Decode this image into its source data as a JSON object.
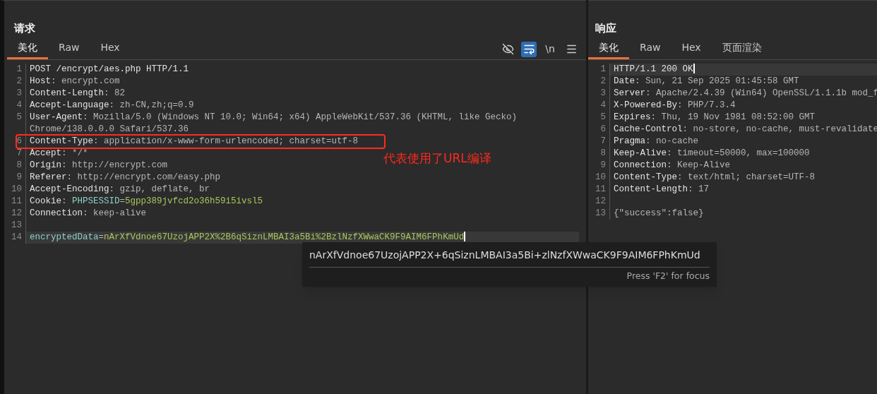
{
  "request": {
    "title": "请求",
    "tabs": [
      {
        "label": "美化",
        "selected": true
      },
      {
        "label": "Raw",
        "selected": false
      },
      {
        "label": "Hex",
        "selected": false
      }
    ],
    "toolbar": [
      {
        "kind": "eye-off",
        "selected": false
      },
      {
        "kind": "wrap",
        "selected": true
      },
      {
        "kind": "newline",
        "label": "\\n",
        "selected": false
      },
      {
        "kind": "menu",
        "selected": false
      }
    ],
    "lines": [
      {
        "number": "1",
        "parts": [
          {
            "text": "POST /encrypt/aes.php HTTP/1.1",
            "kind": "key"
          }
        ],
        "current": false
      },
      {
        "number": "2",
        "parts": [
          {
            "text": "Host",
            "kind": "key"
          },
          {
            "text": ": encrypt.com",
            "kind": "value"
          }
        ],
        "current": false
      },
      {
        "number": "3",
        "parts": [
          {
            "text": "Content-Length",
            "kind": "key"
          },
          {
            "text": ": 82",
            "kind": "value"
          }
        ],
        "current": false
      },
      {
        "number": "4",
        "parts": [
          {
            "text": "Accept-Language",
            "kind": "key"
          },
          {
            "text": ": zh-CN,zh;q=0.9",
            "kind": "value"
          }
        ],
        "current": false
      },
      {
        "number": "5",
        "parts": [
          {
            "text": "User-Agent",
            "kind": "key"
          },
          {
            "text": ": Mozilla/5.0 (Windows NT 10.0; Win64; x64) AppleWebKit/537.36 (KHTML, like Gecko)",
            "kind": "value"
          }
        ],
        "continuation": "Chrome/138.0.0.0 Safari/537.36",
        "current": false
      },
      {
        "number": "6",
        "parts": [
          {
            "text": "Content-Type",
            "kind": "key"
          },
          {
            "text": ": application/x-www-form-urlencoded; charset=utf-8",
            "kind": "value"
          }
        ],
        "current": false
      },
      {
        "number": "7",
        "parts": [
          {
            "text": "Accept",
            "kind": "key"
          },
          {
            "text": ": */*",
            "kind": "value"
          }
        ],
        "current": false
      },
      {
        "number": "8",
        "parts": [
          {
            "text": "Origin",
            "kind": "key"
          },
          {
            "text": ": http://encrypt.com",
            "kind": "value"
          }
        ],
        "current": false
      },
      {
        "number": "9",
        "parts": [
          {
            "text": "Referer",
            "kind": "key"
          },
          {
            "text": ": http://encrypt.com/easy.php",
            "kind": "value"
          }
        ],
        "current": false
      },
      {
        "number": "10",
        "parts": [
          {
            "text": "Accept-Encoding",
            "kind": "key"
          },
          {
            "text": ": gzip, deflate, br",
            "kind": "value"
          }
        ],
        "current": false
      },
      {
        "number": "11",
        "parts": [
          {
            "text": "Cookie",
            "kind": "key"
          },
          {
            "text": ": ",
            "kind": "value"
          },
          {
            "text": "PHPSESSID",
            "kind": "param"
          },
          {
            "text": "=",
            "kind": "value"
          },
          {
            "text": "5gpp389jvfcd2o36h59i5ivsl5",
            "kind": "data"
          }
        ],
        "current": false
      },
      {
        "number": "12",
        "parts": [
          {
            "text": "Connection",
            "kind": "key"
          },
          {
            "text": ": keep-alive",
            "kind": "value"
          }
        ],
        "current": false
      },
      {
        "number": "13",
        "current": false
      },
      {
        "number": "14",
        "parts": [
          {
            "text": "encryptedData",
            "kind": "param"
          },
          {
            "text": "=",
            "kind": "value"
          },
          {
            "text": "nArXfVdnoe67UzojAPP2X%2B6qSiznLMBAI3a5Bi%2BzlNzfXWwaCK9F9AIM6FPhKmUd",
            "kind": "data"
          }
        ],
        "current": true
      }
    ],
    "annotation": {
      "note": "代表使用了URL编译",
      "color": "#ff2a1f"
    },
    "tooltip": {
      "text": "nArXfVdnoe67UzojAPP2X+6qSiznLMBAI3a5Bi+zlNzfXWwaCK9F9AIM6FPhKmUd",
      "hint": "Press 'F2' for focus"
    }
  },
  "response": {
    "title": "响应",
    "tabs": [
      {
        "label": "美化",
        "selected": true
      },
      {
        "label": "Raw",
        "selected": false
      },
      {
        "label": "Hex",
        "selected": false
      },
      {
        "label": "页面渲染",
        "selected": false
      }
    ],
    "lines": [
      {
        "number": "1",
        "parts": [
          {
            "text": "HTTP/1.1 200 OK",
            "kind": "key"
          }
        ],
        "current": true
      },
      {
        "number": "2",
        "parts": [
          {
            "text": "Date",
            "kind": "key"
          },
          {
            "text": ": Sun, 21 Sep 2025 01:45:58 GMT",
            "kind": "value"
          }
        ],
        "current": false
      },
      {
        "number": "3",
        "parts": [
          {
            "text": "Server",
            "kind": "key"
          },
          {
            "text": ": Apache/2.4.39 (Win64) OpenSSL/1.1.1b mod_f",
            "kind": "value"
          }
        ],
        "current": false
      },
      {
        "number": "4",
        "parts": [
          {
            "text": "X-Powered-By",
            "kind": "key"
          },
          {
            "text": ": PHP/7.3.4",
            "kind": "value"
          }
        ],
        "current": false
      },
      {
        "number": "5",
        "parts": [
          {
            "text": "Expires",
            "kind": "key"
          },
          {
            "text": ": Thu, 19 Nov 1981 08:52:00 GMT",
            "kind": "value"
          }
        ],
        "current": false
      },
      {
        "number": "6",
        "parts": [
          {
            "text": "Cache-Control",
            "kind": "key"
          },
          {
            "text": ": no-store, no-cache, must-revalidate",
            "kind": "value"
          }
        ],
        "current": false
      },
      {
        "number": "7",
        "parts": [
          {
            "text": "Pragma",
            "kind": "key"
          },
          {
            "text": ": no-cache",
            "kind": "value"
          }
        ],
        "current": false
      },
      {
        "number": "8",
        "parts": [
          {
            "text": "Keep-Alive",
            "kind": "key"
          },
          {
            "text": ": timeout=50000, max=100000",
            "kind": "value"
          }
        ],
        "current": false
      },
      {
        "number": "9",
        "parts": [
          {
            "text": "Connection",
            "kind": "key"
          },
          {
            "text": ": Keep-Alive",
            "kind": "value"
          }
        ],
        "current": false
      },
      {
        "number": "10",
        "parts": [
          {
            "text": "Content-Type",
            "kind": "key"
          },
          {
            "text": ": text/html; charset=UTF-8",
            "kind": "value"
          }
        ],
        "current": false
      },
      {
        "number": "11",
        "parts": [
          {
            "text": "Content-Length",
            "kind": "key"
          },
          {
            "text": ": 17",
            "kind": "value"
          }
        ],
        "current": false
      },
      {
        "number": "12",
        "current": false
      },
      {
        "number": "13",
        "parts": [
          {
            "text": "{\"success\":false}",
            "kind": "value"
          }
        ],
        "current": false
      }
    ]
  }
}
